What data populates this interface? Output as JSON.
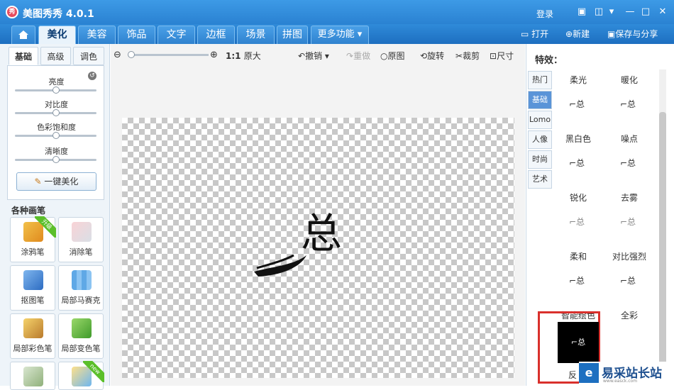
{
  "window": {
    "title": "美图秀秀 4.0.1",
    "login": "登录",
    "logo": "秀"
  },
  "nav": {
    "tabs": [
      "美化",
      "美容",
      "饰品",
      "文字",
      "边框",
      "场景",
      "拼图",
      "更多功能"
    ],
    "open": "打开",
    "new": "新建",
    "save_share": "保存与分享"
  },
  "left": {
    "tabs": [
      "基础",
      "高级",
      "调色"
    ],
    "sliders": [
      {
        "label": "亮度",
        "value": 0.5
      },
      {
        "label": "对比度",
        "value": 0.5
      },
      {
        "label": "色彩饱和度",
        "value": 0.5
      },
      {
        "label": "清晰度",
        "value": 0.5
      }
    ],
    "one_click": "一键美化",
    "brush_title": "各种画笔",
    "brushes": [
      {
        "label": "涂鸦笔",
        "badge": "升级"
      },
      {
        "label": "消除笔"
      },
      {
        "label": "抠图笔"
      },
      {
        "label": "局部马赛克"
      },
      {
        "label": "局部彩色笔"
      },
      {
        "label": "局部变色笔"
      },
      {
        "label": ""
      },
      {
        "label": "",
        "badge": "new"
      }
    ]
  },
  "toolbar": {
    "ratio": "1:1",
    "original_size": "原大",
    "undo": "撤销",
    "redo": "重做",
    "original_image": "原图",
    "rotate": "旋转",
    "crop": "裁剪",
    "size": "尺寸"
  },
  "canvas": {
    "char": "总"
  },
  "right": {
    "title": "特效：",
    "categories": [
      "热门",
      "基础",
      "Lomo",
      "人像",
      "时尚",
      "艺术"
    ],
    "effects": [
      "柔光",
      "暖化",
      "黑白色",
      "噪点",
      "锐化",
      "去雾",
      "柔和",
      "对比强烈",
      "智能绘色",
      "全彩"
    ],
    "selected_partial": "反"
  },
  "watermark": {
    "text": "易采站长站",
    "sub": "www.easck.com"
  },
  "colors": {
    "accent": "#2a82d2",
    "selected_box": "#d9302c"
  }
}
